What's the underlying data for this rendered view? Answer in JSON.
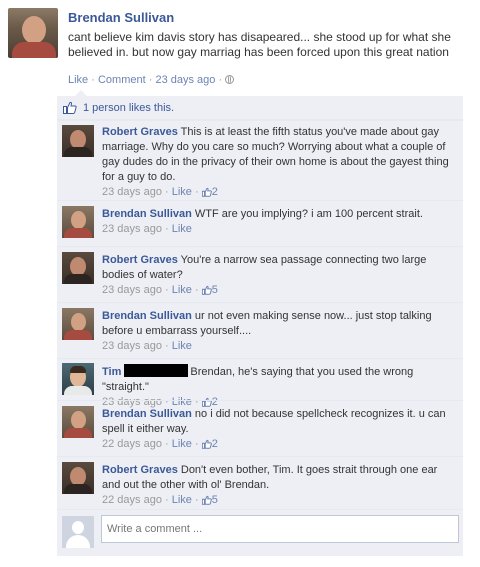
{
  "post": {
    "author": "Brendan Sullivan",
    "text": "cant believe kim davis story has disapeared... she stood up for what she believed in. but now gay marriag has been forced upon this great nation",
    "like_label": "Like",
    "comment_label": "Comment",
    "time": "23 days ago",
    "separator": "·"
  },
  "likes": {
    "text": "1 person likes this."
  },
  "comments": [
    {
      "author": "Robert Graves",
      "text": "This is at least the fifth status you've made about gay marriage. Why do you care so much? Worrying about what a couple of gay dudes do in the privacy of their own home is about the gayest thing for a guy to do.",
      "time": "23 days ago",
      "like_label": "Like",
      "like_count": "2"
    },
    {
      "author": "Brendan Sullivan",
      "text": "WTF are you implying? i am 100 percent strait.",
      "time": "23 days ago",
      "like_label": "Like",
      "like_count": ""
    },
    {
      "author": "Robert Graves",
      "text": "You're a narrow sea passage connecting two large bodies of water?",
      "time": "23 days ago",
      "like_label": "Like",
      "like_count": "5"
    },
    {
      "author": "Brendan Sullivan",
      "text": "ur not even making sense now... just stop talking before u embarrass yourself....",
      "time": "23 days ago",
      "like_label": "Like",
      "like_count": ""
    },
    {
      "author": "Tim",
      "text": "Brendan, he's saying that you used the wrong \"straight.\"",
      "time": "23 days ago",
      "like_label": "Like",
      "like_count": "2"
    },
    {
      "author": "Brendan Sullivan",
      "text": "no i did not because spellcheck recognizes it. u can spell it either way.",
      "time": "22 days ago",
      "like_label": "Like",
      "like_count": "2"
    },
    {
      "author": "Robert Graves",
      "text": "Don't even bother, Tim. It goes strait through one ear and out the other with ol' Brendan.",
      "time": "22 days ago",
      "like_label": "Like",
      "like_count": "5"
    }
  ],
  "composer": {
    "placeholder": "Write a comment ..."
  },
  "icons": {
    "thumb": "thumbs-up-icon",
    "globe": "globe-icon"
  },
  "colors": {
    "link": "#3b5998",
    "meta": "#999999",
    "panel": "#edeff4"
  }
}
